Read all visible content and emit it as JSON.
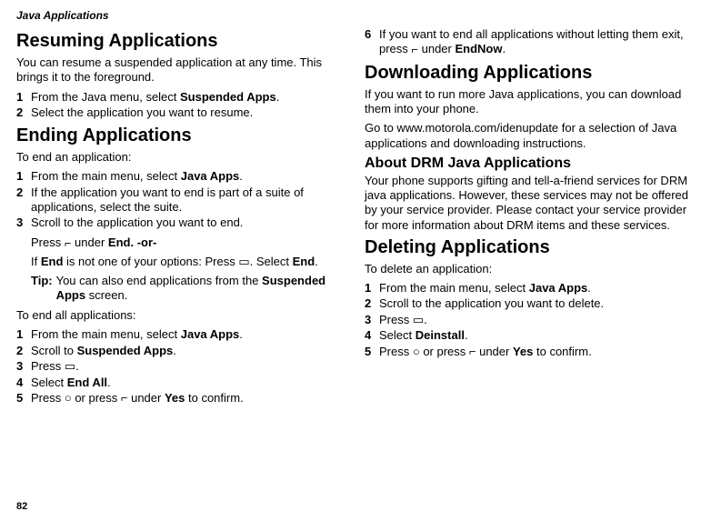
{
  "header": "Java Applications",
  "page_number": "82",
  "left": {
    "resuming": {
      "title": "Resuming Applications",
      "intro": "You can resume a suspended application at any time. This brings it to the foreground.",
      "steps": [
        {
          "n": "1",
          "pre": "From the Java menu, select ",
          "bold": "Suspended Apps",
          "post": "."
        },
        {
          "n": "2",
          "pre": "Select the application you want to resume.",
          "bold": "",
          "post": ""
        }
      ]
    },
    "ending": {
      "title": "Ending Applications",
      "intro": "To end an application:",
      "steps1": [
        {
          "n": "1",
          "pre": "From the main menu, select ",
          "bold": "Java Apps",
          "post": "."
        },
        {
          "n": "2",
          "pre": "If the application you want to end is part of a suite of applications, select the suite.",
          "bold": "",
          "post": ""
        },
        {
          "n": "3",
          "pre": "Scroll to the application you want to end.",
          "bold": "",
          "post": ""
        }
      ],
      "press_end_pre": "Press ",
      "press_end_softkey": "⌐",
      "press_end_mid": " under ",
      "press_end_bold": "End",
      "press_end_or": ". -or-",
      "if_end_pre": "If ",
      "if_end_bold1": "End",
      "if_end_mid": " is not one of your options: Press ",
      "if_end_icon": "▭",
      "if_end_mid2": ". Select ",
      "if_end_bold2": "End",
      "if_end_post": ".",
      "tip_label": "Tip:",
      "tip_pre": "You can also end applications from the ",
      "tip_bold": "Suspended Apps",
      "tip_post": " screen.",
      "end_all_intro": "To end all applications:",
      "steps2": [
        {
          "n": "1",
          "pre": "From the main menu, select ",
          "bold": "Java Apps",
          "post": "."
        },
        {
          "n": "2",
          "pre": "Scroll to ",
          "bold": "Suspended Apps",
          "post": "."
        },
        {
          "n": "3",
          "pre": "Press ",
          "bold": "",
          "post": "",
          "icon": "▭",
          "post2": "."
        },
        {
          "n": "4",
          "pre": "Select ",
          "bold": "End All",
          "post": "."
        },
        {
          "n": "5",
          "pre": "Press ",
          "icon1": "○",
          "mid1": " or press ",
          "icon2": "⌐",
          "mid2": " under ",
          "bold": "Yes",
          "post": " to confirm."
        }
      ]
    }
  },
  "right": {
    "step6": {
      "n": "6",
      "pre": "If you want to end all applications without letting them exit, press ",
      "icon": "⌐",
      "mid": " under ",
      "bold": "EndNow",
      "post": "."
    },
    "downloading": {
      "title": "Downloading Applications",
      "p1": "If you want to run more Java applications, you can download them into your phone.",
      "p2": "Go to www.motorola.com/idenupdate for a selection of Java applications and downloading instructions."
    },
    "about_drm": {
      "title": "About DRM Java Applications",
      "body": "Your phone supports gifting and tell-a-friend services for DRM java applications. However, these services may not be offered by your service provider. Please contact your service provider for more information about DRM items and these services."
    },
    "deleting": {
      "title": "Deleting Applications",
      "intro": "To delete an application:",
      "steps": [
        {
          "n": "1",
          "pre": "From the main menu, select ",
          "bold": "Java Apps",
          "post": "."
        },
        {
          "n": "2",
          "pre": "Scroll to the application you want to delete.",
          "bold": "",
          "post": ""
        },
        {
          "n": "3",
          "pre": "Press ",
          "icon": "▭",
          "post": "."
        },
        {
          "n": "4",
          "pre": "Select ",
          "bold": "Deinstall",
          "post": "."
        },
        {
          "n": "5",
          "pre": "Press ",
          "icon1": "○",
          "mid1": " or press ",
          "icon2": "⌐",
          "mid2": " under ",
          "bold": "Yes",
          "post": " to confirm."
        }
      ]
    }
  }
}
